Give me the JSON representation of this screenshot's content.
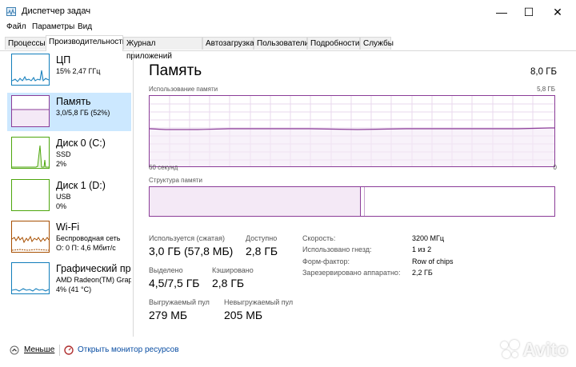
{
  "window": {
    "title": "Диспетчер задач",
    "controls": {
      "minimize": "—",
      "maximize": "☐",
      "close": "✕"
    }
  },
  "menu": {
    "items": [
      "Файл",
      "Параметры",
      "Вид"
    ]
  },
  "tabs": [
    "Процессы",
    "Производительность",
    "Журнал приложений",
    "Автозагрузка",
    "Пользователи",
    "Подробности",
    "Службы"
  ],
  "active_tab": "Производительность",
  "sidebar": {
    "items": [
      {
        "title": "ЦП",
        "sub1": "15% 2,47 ГГц",
        "sub2": "",
        "sub3": "",
        "color": "#117dbb"
      },
      {
        "title": "Память",
        "sub1": "3,0/5,8 ГБ (52%)",
        "sub2": "",
        "sub3": "",
        "color": "#8b3c98"
      },
      {
        "title": "Диск 0 (C:)",
        "sub1": "SSD",
        "sub2": "2%",
        "sub3": "",
        "color": "#4da60c"
      },
      {
        "title": "Диск 1 (D:)",
        "sub1": "USB",
        "sub2": "0%",
        "sub3": "",
        "color": "#4da60c"
      },
      {
        "title": "Wi-Fi",
        "sub1": "Беспроводная сеть",
        "sub2": "О: 0 П: 4,6 Мбит/с",
        "sub3": "",
        "color": "#a74f01"
      },
      {
        "title": "Графический процессор",
        "sub1": "AMD Radeon(TM) Graphics",
        "sub2": "4% (41 °C)",
        "sub3": "",
        "color": "#117dbb"
      }
    ]
  },
  "main": {
    "title": "Память",
    "total": "8,0 ГБ",
    "usage_label": "Использование памяти",
    "usage_max": "5,8 ГБ",
    "time_left": "60 секунд",
    "time_right": "0",
    "structure_label": "Структура памяти",
    "usage_fraction": 0.52,
    "stats": {
      "in_use_label": "Используется (сжатая)",
      "in_use_value": "3,0 ГБ (57,8 МБ)",
      "available_label": "Доступно",
      "available_value": "2,8 ГБ",
      "committed_label": "Выделено",
      "committed_value": "4,5/7,5 ГБ",
      "cached_label": "Кэшировано",
      "cached_value": "2,8 ГБ",
      "paged_label": "Выгружаемый пул",
      "paged_value": "279 МБ",
      "nonpaged_label": "Невыгружаемый пул",
      "nonpaged_value": "205 МБ"
    },
    "details": {
      "speed_label": "Скорость:",
      "speed_value": "3200 МГц",
      "slots_label": "Использовано гнезд:",
      "slots_value": "1 из 2",
      "form_label": "Форм-фактор:",
      "form_value": "Row of chips",
      "reserved_label": "Зарезервировано аппаратно:",
      "reserved_value": "2,2 ГБ"
    }
  },
  "footer": {
    "less_label": "Меньше",
    "monitor_label": "Открыть монитор ресурсов"
  },
  "watermark": "Avito"
}
